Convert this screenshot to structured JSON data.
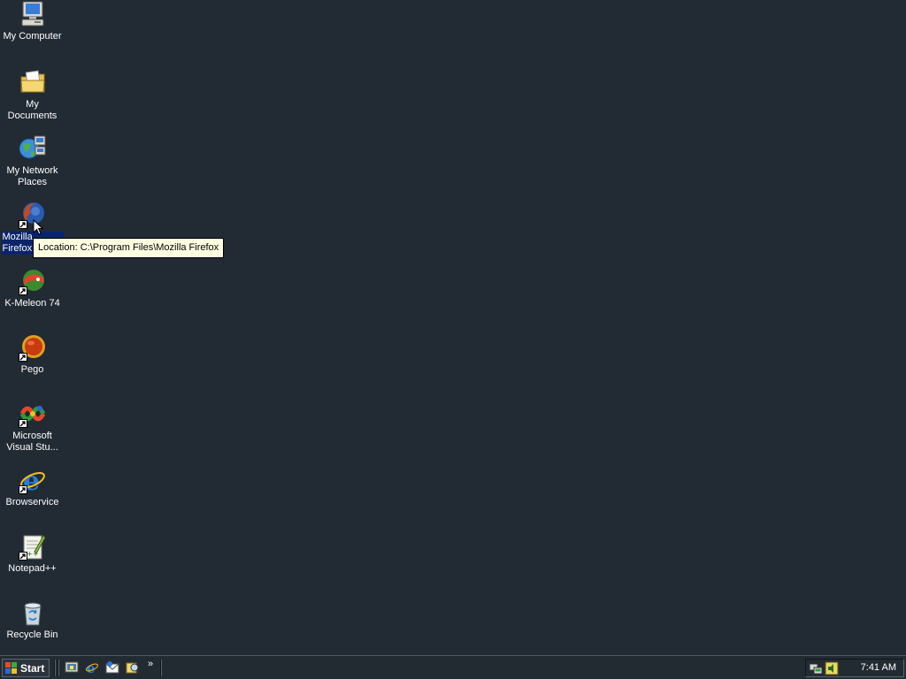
{
  "desktop": {
    "icons": [
      {
        "label": "My Computer",
        "icon": "computer-icon"
      },
      {
        "label": "My Documents",
        "icon": "folder-icon"
      },
      {
        "label": "My Network Places",
        "icon": "network-icon"
      },
      {
        "label": "Mozilla Firefox",
        "icon": "firefox-icon",
        "selected": true
      },
      {
        "label": "K-Meleon 74",
        "icon": "k-meleon-icon"
      },
      {
        "label": "Pego",
        "icon": "pego-icon"
      },
      {
        "label": "Microsoft Visual Stu...",
        "icon": "visual-studio-icon"
      },
      {
        "label": "Browservice",
        "icon": "internet-explorer-icon"
      },
      {
        "label": "Notepad++",
        "icon": "notepad-plus-plus-icon"
      },
      {
        "label": "Recycle Bin",
        "icon": "recycle-bin-icon"
      }
    ],
    "tooltip": "Location: C:\\Program Files\\Mozilla Firefox",
    "background_color": "#222a33"
  },
  "taskbar": {
    "start_label": "Start",
    "quick_launch": [
      "show-desktop-icon",
      "internet-explorer-icon",
      "outlook-express-icon",
      "search-icon"
    ],
    "more_label": "»",
    "tray_icons": [
      "network-tray-icon",
      "volume-tray-icon"
    ],
    "clock": "7:41 AM"
  }
}
